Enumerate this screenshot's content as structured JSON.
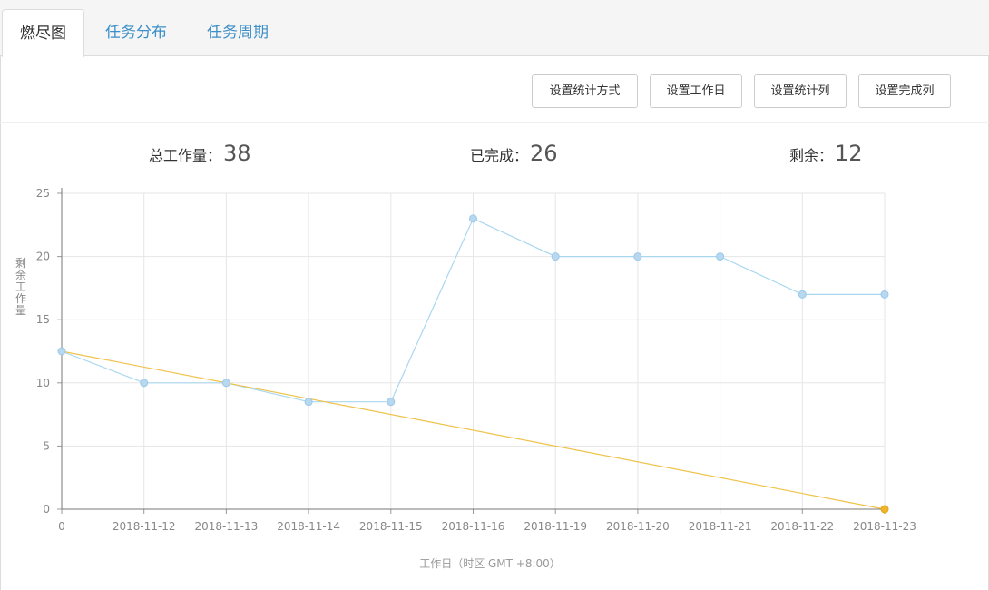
{
  "tabs": [
    {
      "label": "燃尽图",
      "active": true
    },
    {
      "label": "任务分布",
      "active": false
    },
    {
      "label": "任务周期",
      "active": false
    }
  ],
  "toolbar": {
    "buttons": [
      "设置统计方式",
      "设置工作日",
      "设置统计列",
      "设置完成列"
    ]
  },
  "summary": {
    "total_label": "总工作量：",
    "total_value": "38",
    "done_label": "已完成：",
    "done_value": "26",
    "remain_label": "剩余：",
    "remain_value": "12"
  },
  "colors": {
    "actual": "#a9d7f0",
    "actual_point": "#b8d8ef",
    "ideal": "#f0c24a",
    "ideal_point": "#f0b429",
    "tab_link": "#3a8fc8"
  },
  "chart_data": {
    "type": "line",
    "categories": [
      "0",
      "2018-11-12",
      "2018-11-13",
      "2018-11-14",
      "2018-11-15",
      "2018-11-16",
      "2018-11-19",
      "2018-11-20",
      "2018-11-21",
      "2018-11-22",
      "2018-11-23"
    ],
    "series": [
      {
        "values": [
          12.5,
          10,
          10,
          8.5,
          8.5,
          23,
          20,
          20,
          20,
          17,
          17
        ]
      },
      {
        "values": [
          12.5,
          null,
          null,
          null,
          null,
          null,
          null,
          null,
          null,
          null,
          0
        ]
      }
    ],
    "xlabel": "工作日（时区 GMT +8:00）",
    "ylabel": "剩余工作量",
    "ylim": [
      0,
      25
    ],
    "yticks": [
      "0",
      "5",
      "10",
      "15",
      "20",
      "25"
    ],
    "grid": true
  }
}
